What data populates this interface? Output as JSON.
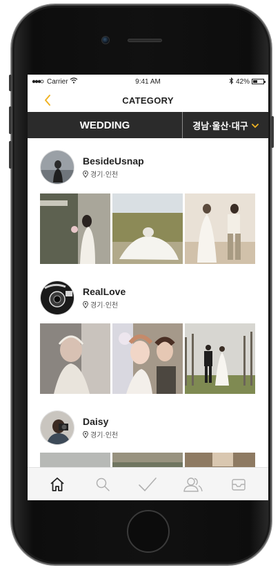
{
  "status_bar": {
    "carrier": "Carrier",
    "time": "9:41 AM",
    "battery_text": "42%",
    "battery_level": 0.42
  },
  "nav": {
    "title": "CATEGORY",
    "back_icon": "chevron-left-icon"
  },
  "category": {
    "main_label": "WEDDING",
    "region_label": "경남·울산·대구"
  },
  "profiles": [
    {
      "name": "BesideUsnap",
      "location": "경기·인천"
    },
    {
      "name": "RealLove",
      "location": "경기·인천"
    },
    {
      "name": "Daisy",
      "location": "경기·인천"
    }
  ],
  "tabs": [
    {
      "icon": "home-icon",
      "active": true
    },
    {
      "icon": "search-icon",
      "active": false
    },
    {
      "icon": "check-icon",
      "active": false
    },
    {
      "icon": "users-icon",
      "active": false
    },
    {
      "icon": "inbox-icon",
      "active": false
    }
  ],
  "colors": {
    "accent": "#f0b323",
    "category_bar": "#2b2b2b",
    "tab_inactive": "#b0b0b0",
    "tab_active": "#222222"
  }
}
